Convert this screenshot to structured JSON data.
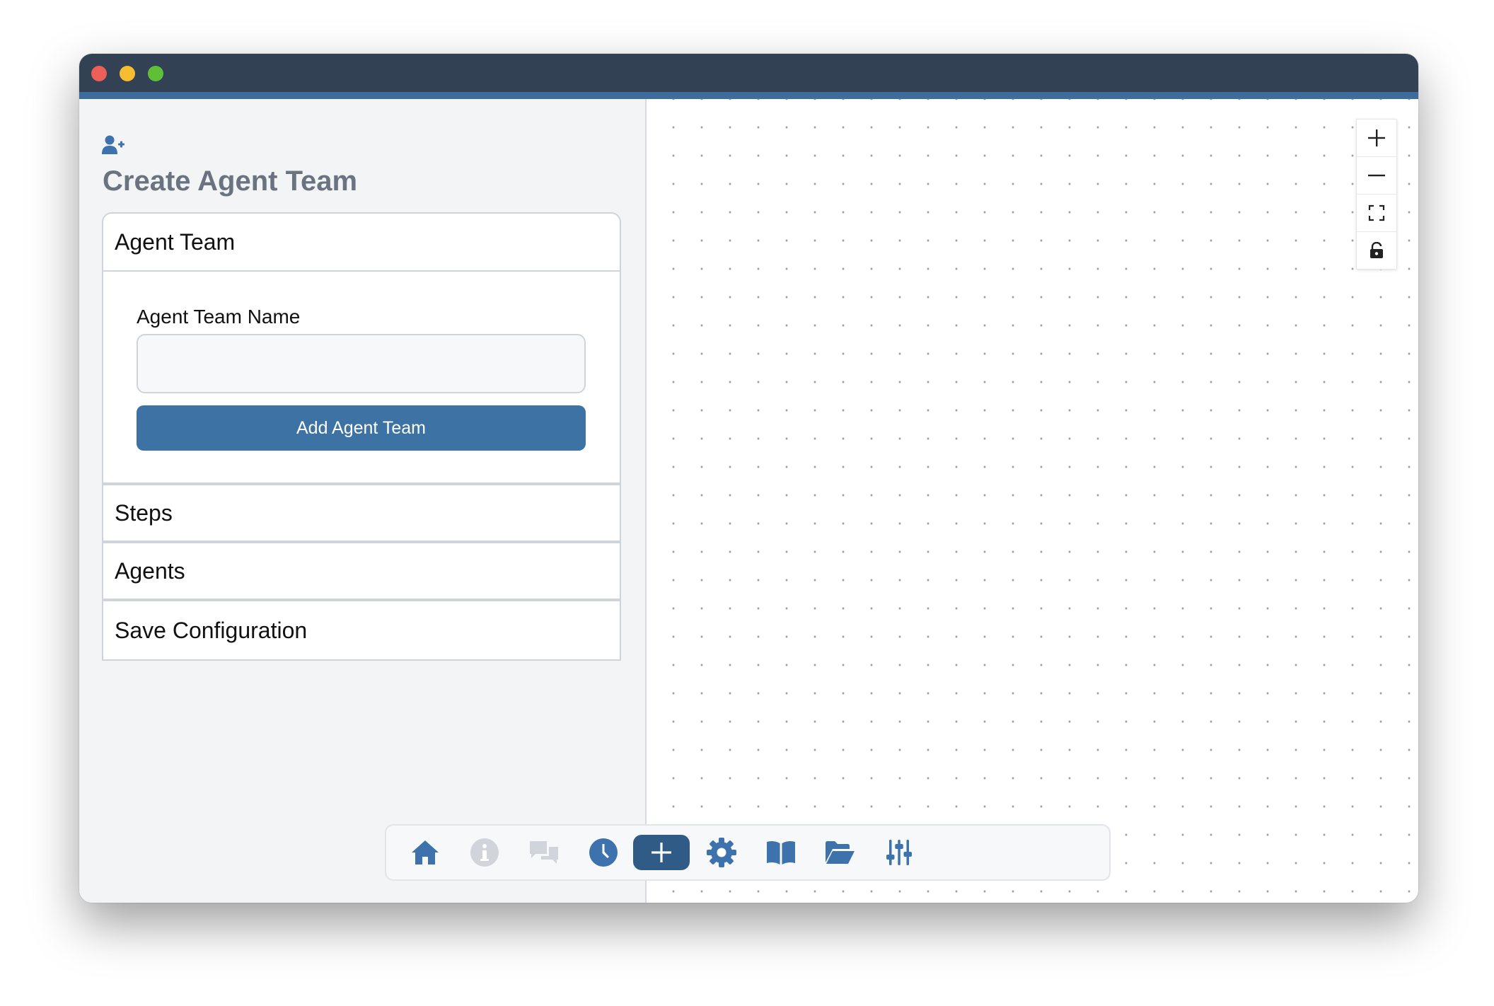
{
  "sidebar": {
    "title": "Create Agent Team",
    "title_icon": "user-plus-icon",
    "sections": [
      {
        "label": "Agent Team",
        "expanded": true
      },
      {
        "label": "Steps",
        "expanded": false
      },
      {
        "label": "Agents",
        "expanded": false
      },
      {
        "label": "Save Configuration",
        "expanded": false
      }
    ],
    "form": {
      "name_label": "Agent Team Name",
      "name_value": "",
      "name_placeholder": "",
      "submit_label": "Add Agent Team"
    }
  },
  "canvas": {
    "controls": [
      "zoom-in-icon",
      "zoom-out-icon",
      "fit-view-icon",
      "lock-icon"
    ]
  },
  "toolbar": {
    "items": [
      "home-icon",
      "info-icon",
      "chat-icon",
      "history-icon",
      "add-icon",
      "settings-icon",
      "book-icon",
      "folder-open-icon",
      "sliders-icon"
    ],
    "active": "add-icon"
  },
  "colors": {
    "titlebar": "#334155",
    "accent": "#3d72a4",
    "icon_blue": "#3d72ad",
    "icon_disabled": "#d1d5db"
  }
}
